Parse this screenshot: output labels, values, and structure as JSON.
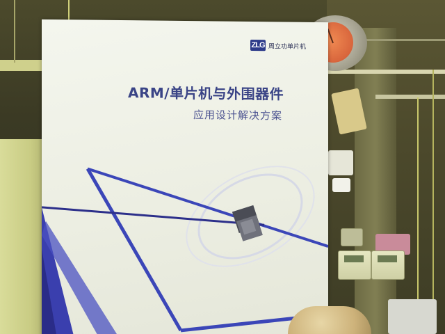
{
  "booklet": {
    "logo_mark": "ZLG",
    "logo_text": "周立功单片机",
    "title": "ARM/单片机与外围器件",
    "subtitle": "应用设计解决方案"
  },
  "icons": {
    "logo": "zlg-logo-icon",
    "chip": "chip-icon",
    "clock": "clock-icon"
  },
  "colors": {
    "title": "#3a4486",
    "accent_blue": "#3b46b8",
    "dark_blue": "#2c2f8a",
    "clock_face": "#d8653c",
    "paper": "#eef0e4"
  }
}
